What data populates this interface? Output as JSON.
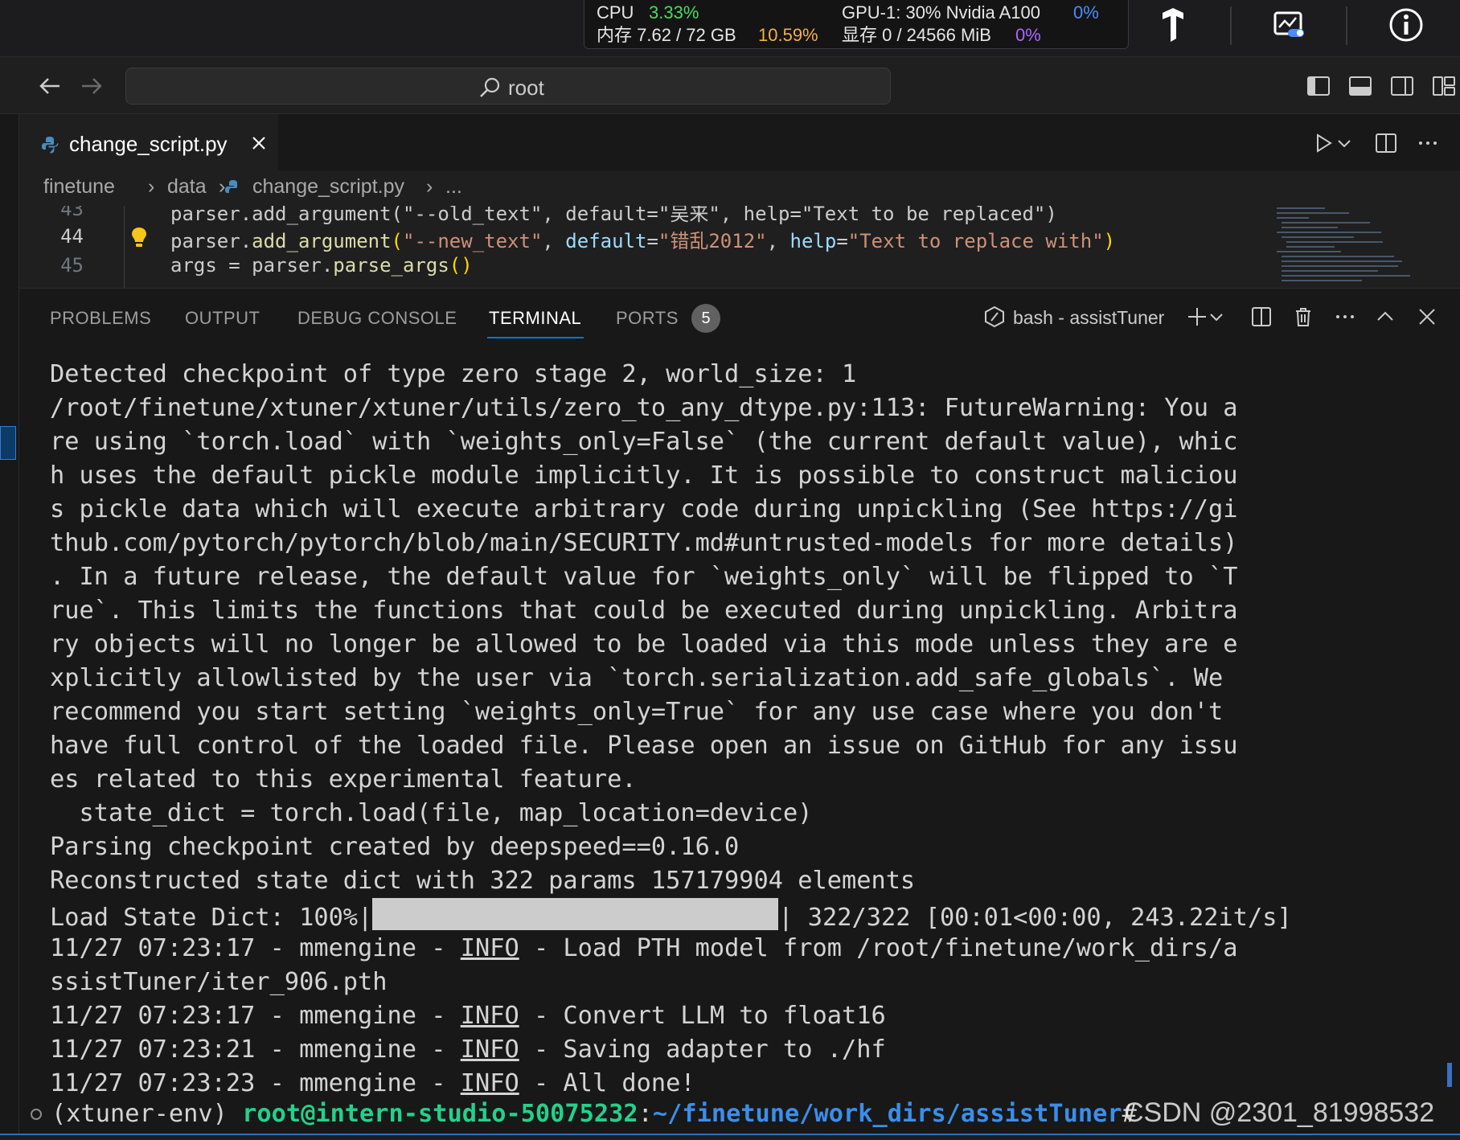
{
  "monitor": {
    "cpu_label": "CPU",
    "cpu_value": "3.33%",
    "mem_label": "内存 7.62 / 72 GB",
    "mem_value": "10.59%",
    "gpu_label": "GPU-1: 30% Nvidia A100",
    "gpu_value": "0%",
    "vram_label": "显存 0 / 24566 MiB",
    "vram_value": "0%"
  },
  "titlebar": {
    "search_text": "root"
  },
  "tab": {
    "filename": "change_script.py"
  },
  "breadcrumb": {
    "part1": "finetune",
    "part2": "data",
    "part3": "change_script.py",
    "part4": "..."
  },
  "code": {
    "line_numbers": [
      "43",
      "44",
      "45"
    ],
    "line43": "parser.add_argument(\"--old_text\", default=\"吴来\", help=\"Text to be replaced\")",
    "line44": {
      "a": "parser.",
      "fn": "add_argument",
      "p1": "(",
      "s1": "\"--new_text\"",
      "c1": ", ",
      "k1": "default",
      "e1": "=",
      "s2": "\"错乱2012\"",
      "c2": ", ",
      "k2": "help",
      "e2": "=",
      "s3": "\"Text to replace with\"",
      "p2": ")"
    },
    "line45": {
      "a": "args = parser.",
      "fn": "parse_args",
      "p": "()"
    }
  },
  "panel": {
    "tabs": [
      "PROBLEMS",
      "OUTPUT",
      "DEBUG CONSOLE",
      "TERMINAL",
      "PORTS"
    ],
    "ports_count": "5",
    "terminal_name": "bash - assistTuner"
  },
  "terminal": {
    "lines": [
      "Detected checkpoint of type zero stage 2, world_size: 1",
      "/root/finetune/xtuner/xtuner/utils/zero_to_any_dtype.py:113: FutureWarning: You a",
      "re using `torch.load` with `weights_only=False` (the current default value), whic",
      "h uses the default pickle module implicitly. It is possible to construct maliciou",
      "s pickle data which will execute arbitrary code during unpickling (See https://gi",
      "thub.com/pytorch/pytorch/blob/main/SECURITY.md#untrusted-models for more details)",
      ". In a future release, the default value for `weights_only` will be flipped to `T",
      "rue`. This limits the functions that could be executed during unpickling. Arbitra",
      "ry objects will no longer be allowed to be loaded via this mode unless they are e",
      "xplicitly allowlisted by the user via `torch.serialization.add_safe_globals`. We",
      "recommend you start setting `weights_only=True` for any use case where you don't",
      "have full control of the loaded file. Please open an issue on GitHub for any issu",
      "es related to this experimental feature.",
      "  state_dict = torch.load(file, map_location=device)",
      "Parsing checkpoint created by deepspeed==0.16.0",
      "Reconstructed state dict with 322 params 157179904 elements"
    ],
    "progress_prefix": "Load State Dict: 100%|",
    "progress_suffix": "| 322/322 [00:01<00:00, 243.22it/s]",
    "progress_fraction": 1.0,
    "log1_prefix": "11/27 07:23:17 - mmengine - ",
    "log1_level": "INFO",
    "log1_msg": " - Load PTH model from /root/finetune/work_dirs/a",
    "log1_cont": "ssistTuner/iter_906.pth",
    "log2_prefix": "11/27 07:23:17 - mmengine - ",
    "log2_level": "INFO",
    "log2_msg": " - Convert LLM to float16",
    "log3_prefix": "11/27 07:23:21 - mmengine - ",
    "log3_level": "INFO",
    "log3_msg": " - Saving adapter to ./hf",
    "log4_prefix": "11/27 07:23:23 - mmengine - ",
    "log4_level": "INFO",
    "log4_msg": " - All done!",
    "prompt_env": "(xtuner-env) ",
    "prompt_user": "root@intern-studio-50075232",
    "prompt_colon": ":",
    "prompt_path": "~/finetune/work_dirs/assistTuner",
    "prompt_end": "#"
  },
  "watermark": "CSDN @2301_81998532",
  "colors": {
    "accent": "#0078d4",
    "prompt_user": "#23d18b",
    "prompt_path": "#3b8eea",
    "cpu": "#4cd964",
    "mem": "#f5b042",
    "gpu": "#4a8cff",
    "vram": "#b066ff"
  }
}
